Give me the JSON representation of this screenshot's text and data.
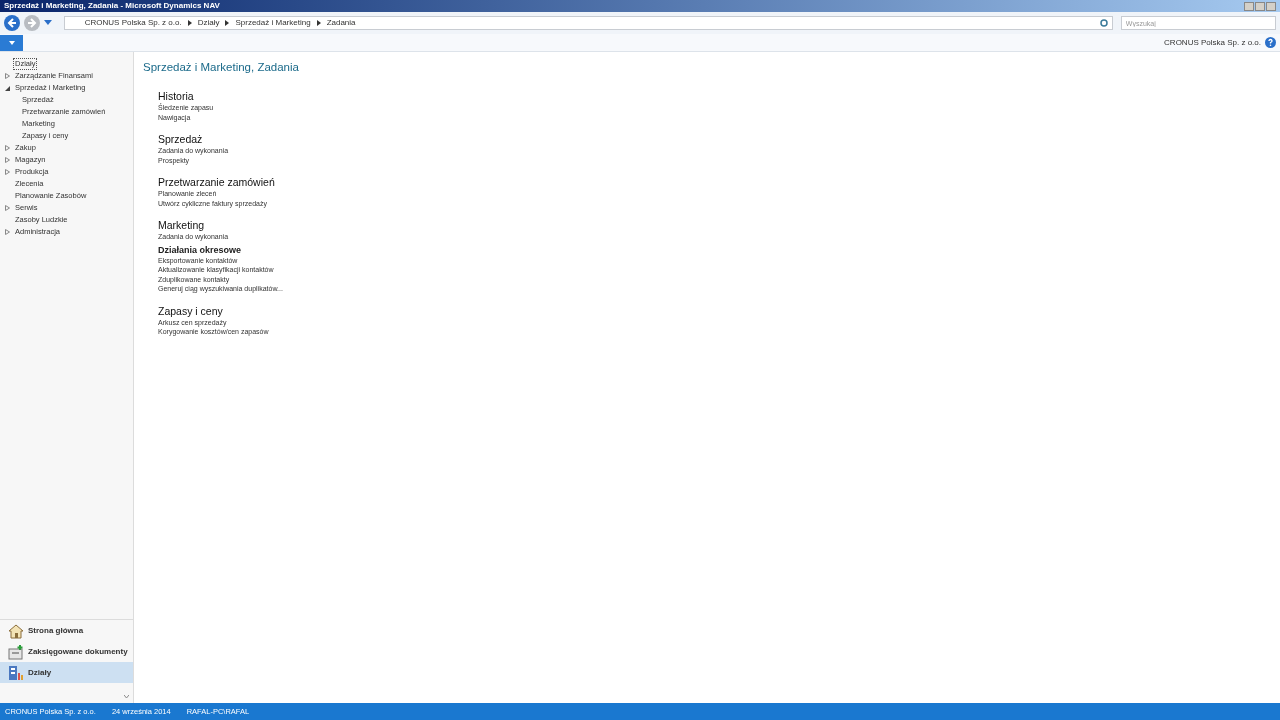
{
  "window": {
    "title": "Sprzedaż i Marketing, Zadania - Microsoft Dynamics NAV"
  },
  "breadcrumb": [
    "CRONUS Polska Sp. z o.o.",
    "Działy",
    "Sprzedaż i Marketing",
    "Zadania"
  ],
  "search": {
    "placeholder": "Wyszukaj"
  },
  "company": "CRONUS Polska Sp. z o.o.",
  "tree": {
    "root": {
      "label": "Działy",
      "selected": true
    },
    "items": [
      {
        "label": "Zarządzanie Finansami",
        "kind": "group",
        "expanded": false
      },
      {
        "label": "Sprzedaż i Marketing",
        "kind": "group",
        "expanded": true,
        "children": [
          {
            "label": "Sprzedaż"
          },
          {
            "label": "Przetwarzanie zamówień"
          },
          {
            "label": "Marketing"
          },
          {
            "label": "Zapasy i ceny"
          }
        ]
      },
      {
        "label": "Zakup",
        "kind": "group",
        "expanded": false
      },
      {
        "label": "Magazyn",
        "kind": "group",
        "expanded": false
      },
      {
        "label": "Produkcja",
        "kind": "group",
        "expanded": false
      },
      {
        "label": "Zlecenia",
        "kind": "leaf"
      },
      {
        "label": "Planowanie Zasobów",
        "kind": "leaf"
      },
      {
        "label": "Serwis",
        "kind": "group",
        "expanded": false
      },
      {
        "label": "Zasoby Ludzkie",
        "kind": "leaf"
      },
      {
        "label": "Administracja",
        "kind": "group",
        "expanded": false
      }
    ]
  },
  "nav_buttons": [
    {
      "label": "Strona główna",
      "kind": "home",
      "selected": false
    },
    {
      "label": "Zaksięgowane dokumenty",
      "kind": "posted",
      "selected": false
    },
    {
      "label": "Działy",
      "kind": "departments",
      "selected": true
    }
  ],
  "page_title": "Sprzedaż i Marketing, Zadania",
  "sections": [
    {
      "heading": "Historia",
      "kind": "group",
      "links": [
        "Śledzenie zapasu",
        "Nawigacja"
      ]
    },
    {
      "heading": "Sprzedaż",
      "kind": "group",
      "links": [
        "Zadania do wykonania",
        "Prospekty"
      ]
    },
    {
      "heading": "Przetwarzanie zamówień",
      "kind": "group",
      "links": [
        "Planowanie zleceń",
        "Utwórz cykliczne faktury sprzedaży"
      ]
    },
    {
      "heading": "Marketing",
      "kind": "group",
      "links": [
        "Zadania do wykonania"
      ]
    },
    {
      "heading": "Działania okresowe",
      "kind": "subgroup",
      "links": [
        "Eksportowanie kontaktów",
        "Aktualizowanie klasyfikacji kontaktów",
        "Zduplikowane kontakty",
        "Generuj ciąg wyszukiwania duplikatów..."
      ]
    },
    {
      "heading": "Zapasy i ceny",
      "kind": "group",
      "links": [
        "Arkusz cen sprzedaży",
        "Korygowanie kosztów/cen zapasów"
      ]
    }
  ],
  "status_bar": [
    "CRONUS Polska Sp. z o.o.",
    "24 września 2014",
    "RAFAL-PC\\RAFAL"
  ]
}
